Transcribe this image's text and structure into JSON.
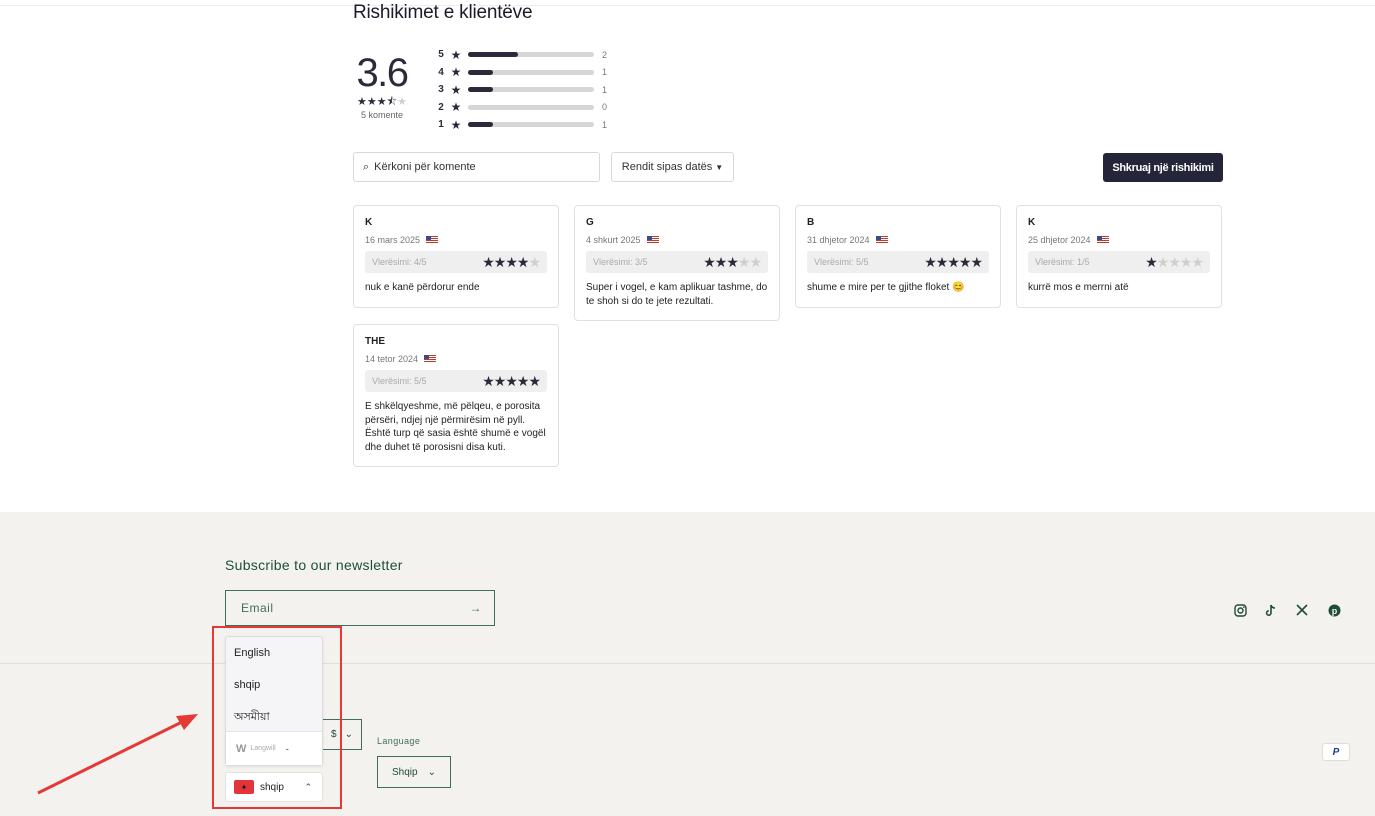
{
  "reviews": {
    "title": "Rishikimet e klientëve",
    "average": "3.6",
    "average_stars": 3.5,
    "total_label": "5 komente",
    "distribution": [
      {
        "stars": "5",
        "count": "2",
        "fraction": 0.4
      },
      {
        "stars": "4",
        "count": "1",
        "fraction": 0.2
      },
      {
        "stars": "3",
        "count": "1",
        "fraction": 0.2
      },
      {
        "stars": "2",
        "count": "0",
        "fraction": 0.0
      },
      {
        "stars": "1",
        "count": "1",
        "fraction": 0.2
      }
    ],
    "search_placeholder": "Kërkoni për komente",
    "sort_label": "Rendit sipas datës",
    "write_label": "Shkruaj një rishikimi",
    "cards": [
      {
        "name": "K",
        "date": "16 mars 2025",
        "rating_label": "Vlerësimi: 4/5",
        "rating": 4,
        "text": "nuk e kanë përdorur ende"
      },
      {
        "name": "G",
        "date": "4 shkurt 2025",
        "rating_label": "Vlerësimi: 3/5",
        "rating": 3,
        "text": "Super i vogel, e kam aplikuar tashme, do te shoh si do te jete rezultati."
      },
      {
        "name": "B",
        "date": "31 dhjetor 2024",
        "rating_label": "Vlerësimi: 5/5",
        "rating": 5,
        "text": "shume e mire per te gjithe floket 😊"
      },
      {
        "name": "K",
        "date": "25 dhjetor 2024",
        "rating_label": "Vlerësimi: 1/5",
        "rating": 1,
        "text": "kurrë mos e merrni atë"
      },
      {
        "name": "THE",
        "date": "14 tetor 2024",
        "rating_label": "Vlerësimi: 5/5",
        "rating": 5,
        "text": "E shkëlqyeshme, më pëlqeu, e porosita përsëri, ndjej një përmirësim në pyll. Është turp që sasia është shumë e vogël dhe duhet të porosisni disa kuti."
      }
    ]
  },
  "footer": {
    "newsletter_title": "Subscribe to our newsletter",
    "email_placeholder": "Email",
    "social_icons": [
      "instagram-icon",
      "tiktok-icon",
      "x-icon",
      "pinterest-icon"
    ],
    "currency_value": "$",
    "language_label": "Language",
    "language_value": "Shqip",
    "payment_icon": "paypal-icon"
  },
  "language_switcher": {
    "options": [
      "English",
      "shqip",
      "অসমীয়া"
    ],
    "brand": "Langwill",
    "current": "shqip",
    "dash": "-"
  },
  "colors": {
    "footer_bg": "#f3f2ef",
    "footer_accent": "#3f6e5c",
    "primary_button": "#25253a",
    "highlight": "#e53935"
  }
}
